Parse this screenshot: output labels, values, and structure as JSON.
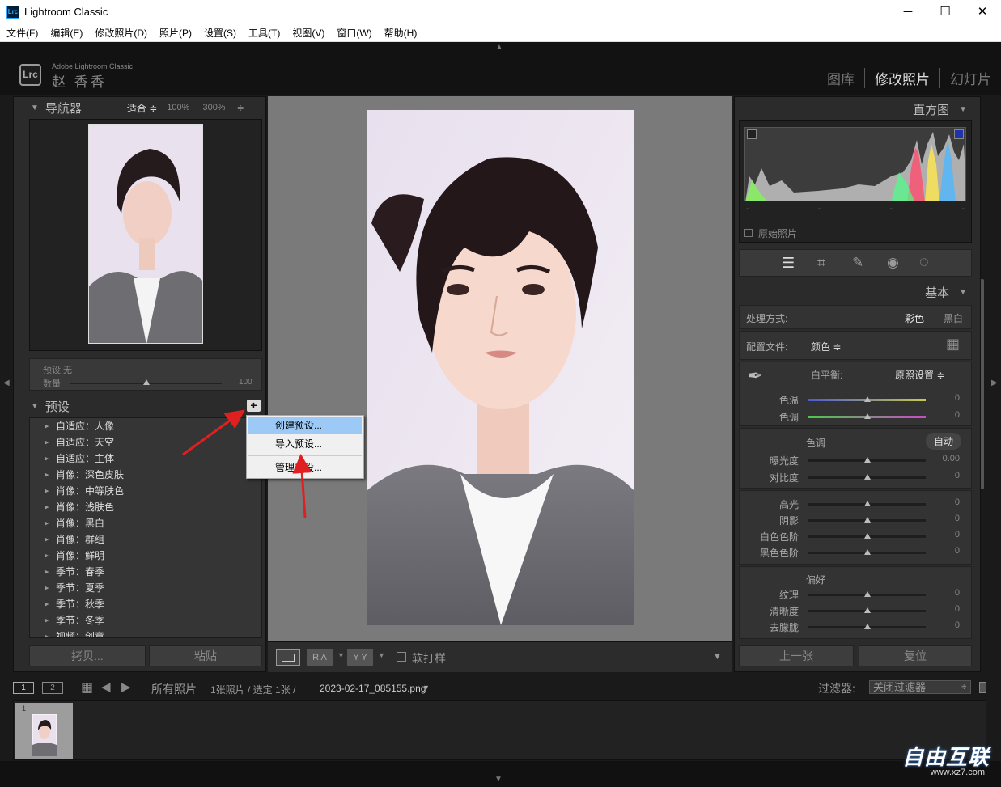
{
  "window": {
    "title": "Lightroom Classic",
    "logo": "Lrc",
    "minimize": "─",
    "maximize": "☐",
    "close": "✕"
  },
  "menu": [
    "文件(F)",
    "编辑(E)",
    "修改照片(D)",
    "照片(P)",
    "设置(S)",
    "工具(T)",
    "视图(V)",
    "窗口(W)",
    "帮助(H)"
  ],
  "identity": {
    "logo": "Lrc",
    "product": "Adobe Lightroom Classic",
    "user": "赵 香香"
  },
  "modules": [
    "图库",
    "修改照片",
    "幻灯片"
  ],
  "navigator": {
    "title": "导航器",
    "zoom_fit": "适合 ≑",
    "zoom_100": "100%",
    "zoom_300": "300%",
    "zoom_more": "≑"
  },
  "preset_info": {
    "preset_label": "预设:无",
    "amount_label": "数量",
    "amount_value": "100",
    "amount_fraction": 0.5
  },
  "presets": {
    "title": "预设",
    "add_icon": "+",
    "items": [
      "自适应：人像",
      "自适应：天空",
      "自适应：主体",
      "肖像：深色皮肤",
      "肖像：中等肤色",
      "肖像：浅肤色",
      "肖像：黑白",
      "肖像：群组",
      "肖像：鲜明",
      "季节：春季",
      "季节：夏季",
      "季节：秋季",
      "季节：冬季",
      "视频：创意"
    ]
  },
  "context_menu": {
    "items": [
      "创建预设...",
      "导入预设...",
      "管理预设..."
    ]
  },
  "left_buttons": {
    "copy": "拷贝...",
    "paste": "粘贴"
  },
  "toolbar": {
    "ra": "R A",
    "yy": "Y Y",
    "softproof": "软打样"
  },
  "histogram": {
    "title": "直方图",
    "ticks": [
      "-",
      "-",
      "-",
      "-"
    ],
    "original": "原始照片"
  },
  "basic": {
    "title": "基本",
    "treatment_label": "处理方式:",
    "color": "彩色",
    "bw": "黑白",
    "profile_label": "配置文件:",
    "profile_value": "颜色 ≑",
    "wb_label": "白平衡:",
    "wb_value": "原照设置 ≑",
    "wb_sliders": [
      {
        "label": "色温",
        "value": "0"
      },
      {
        "label": "色调",
        "value": "0"
      }
    ],
    "tone_title": "色调",
    "auto": "自动",
    "tone_sliders": [
      {
        "label": "曝光度",
        "value": "0.00"
      },
      {
        "label": "对比度",
        "value": "0"
      }
    ],
    "light_sliders": [
      {
        "label": "高光",
        "value": "0"
      },
      {
        "label": "阴影",
        "value": "0"
      },
      {
        "label": "白色色阶",
        "value": "0"
      },
      {
        "label": "黑色色阶",
        "value": "0"
      }
    ],
    "presence_title": "偏好",
    "presence_sliders": [
      {
        "label": "纹理",
        "value": "0"
      },
      {
        "label": "清晰度",
        "value": "0"
      },
      {
        "label": "去朦胧",
        "value": "0"
      }
    ]
  },
  "right_buttons": {
    "prev": "上一张",
    "reset": "复位"
  },
  "filmbar": {
    "view1": "1",
    "view2": "2",
    "source": "所有照片",
    "count": "1张照片 / 选定 1张 /",
    "filename": "2023-02-17_085155.png",
    "filter_label": "过滤器:",
    "filter_value": "关闭过滤器"
  },
  "thumb": {
    "index": "1"
  },
  "watermark": {
    "brand": "自由互联",
    "site": "www.xz7.com"
  }
}
